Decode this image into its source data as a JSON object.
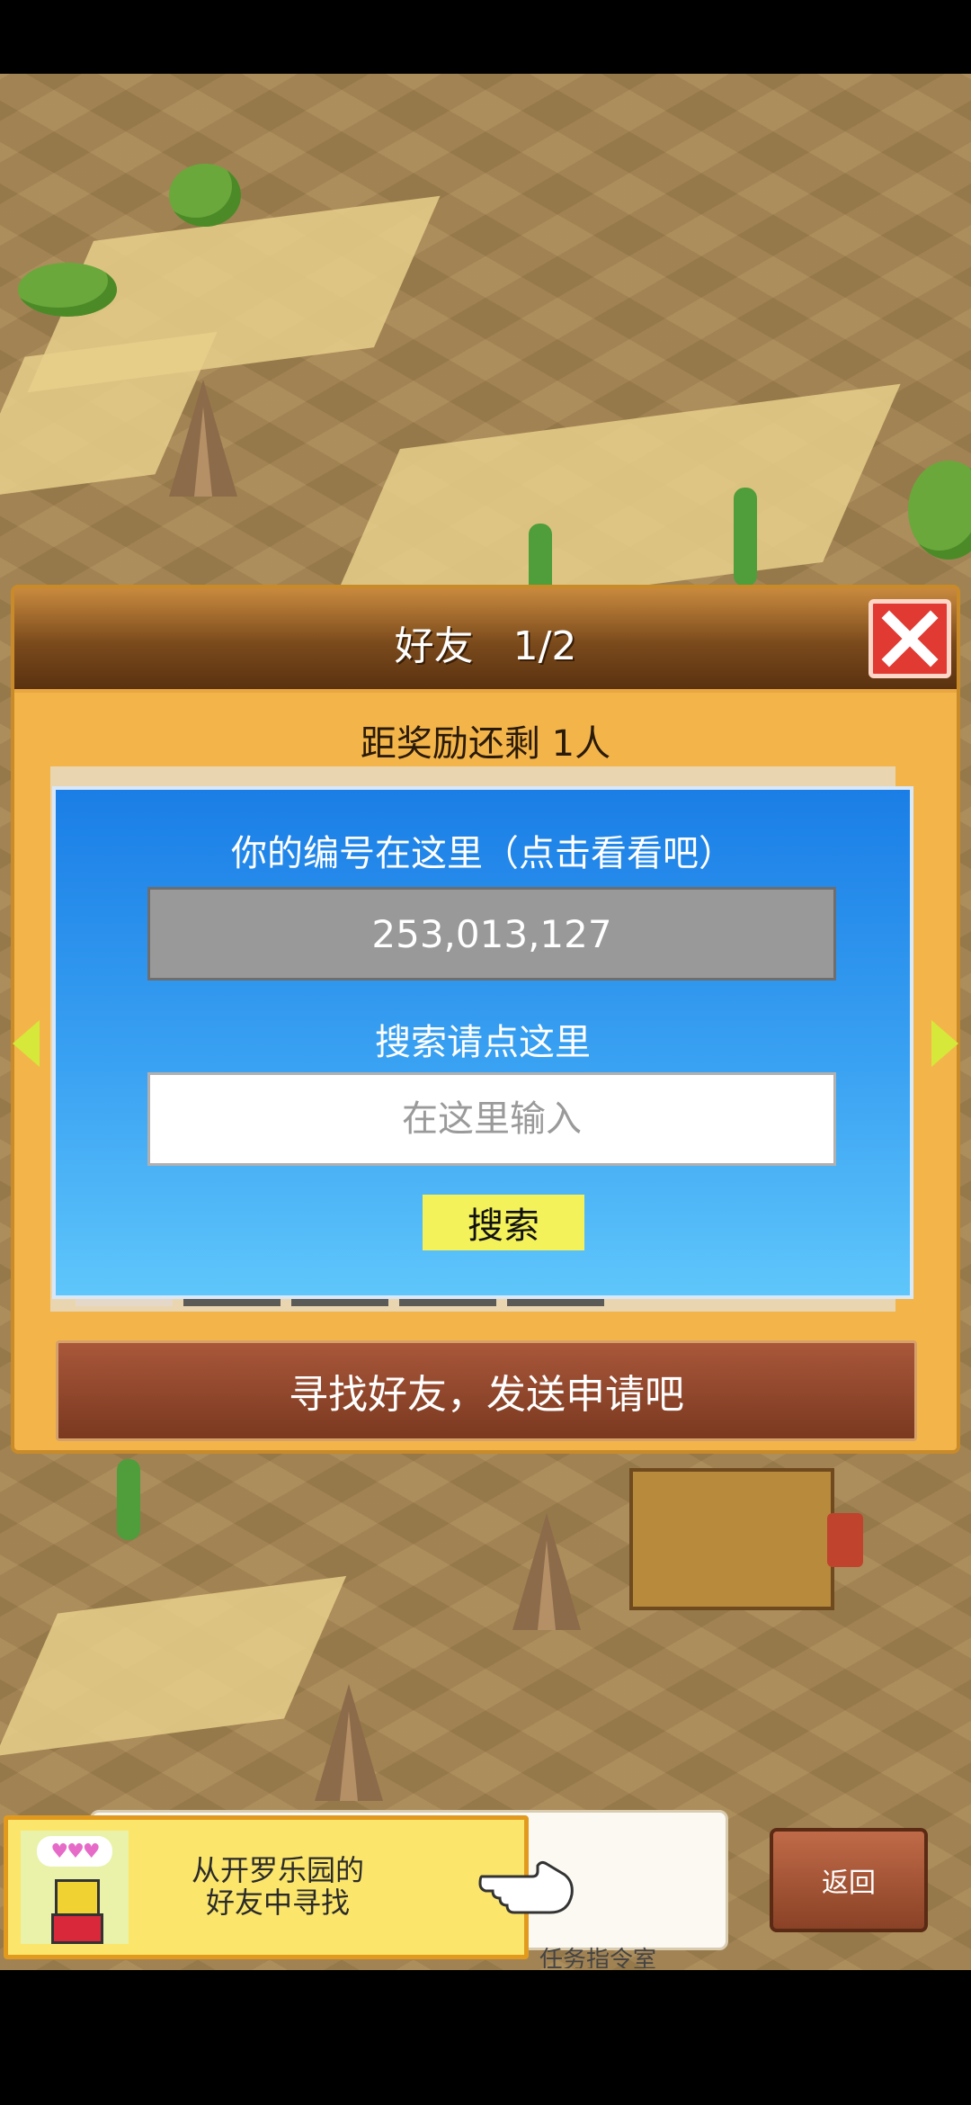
{
  "dialog": {
    "title": "好友　1/2",
    "reward_remaining": "距奖励还剩 1人",
    "id_label": "你的编号在这里（点击看看吧）",
    "player_id": "253,013,127",
    "search_label": "搜索请点这里",
    "search_placeholder": "在这里输入",
    "search_button": "搜索",
    "find_friends_button": "寻找好友，发送申请吧",
    "close_icon": "close-icon"
  },
  "tip": {
    "text_line1": "从开罗乐园的",
    "text_line2": "好友中寻找",
    "hearts": "♥♥♥",
    "partial_text": "任务指令室"
  },
  "back_button": "返回",
  "colors": {
    "dialog_bg": "#f3b54a",
    "panel_blue": "#1a7ee6",
    "close_red": "#e03a32",
    "search_button_yellow": "#f4f25a",
    "find_button_brown": "#7a3920"
  }
}
